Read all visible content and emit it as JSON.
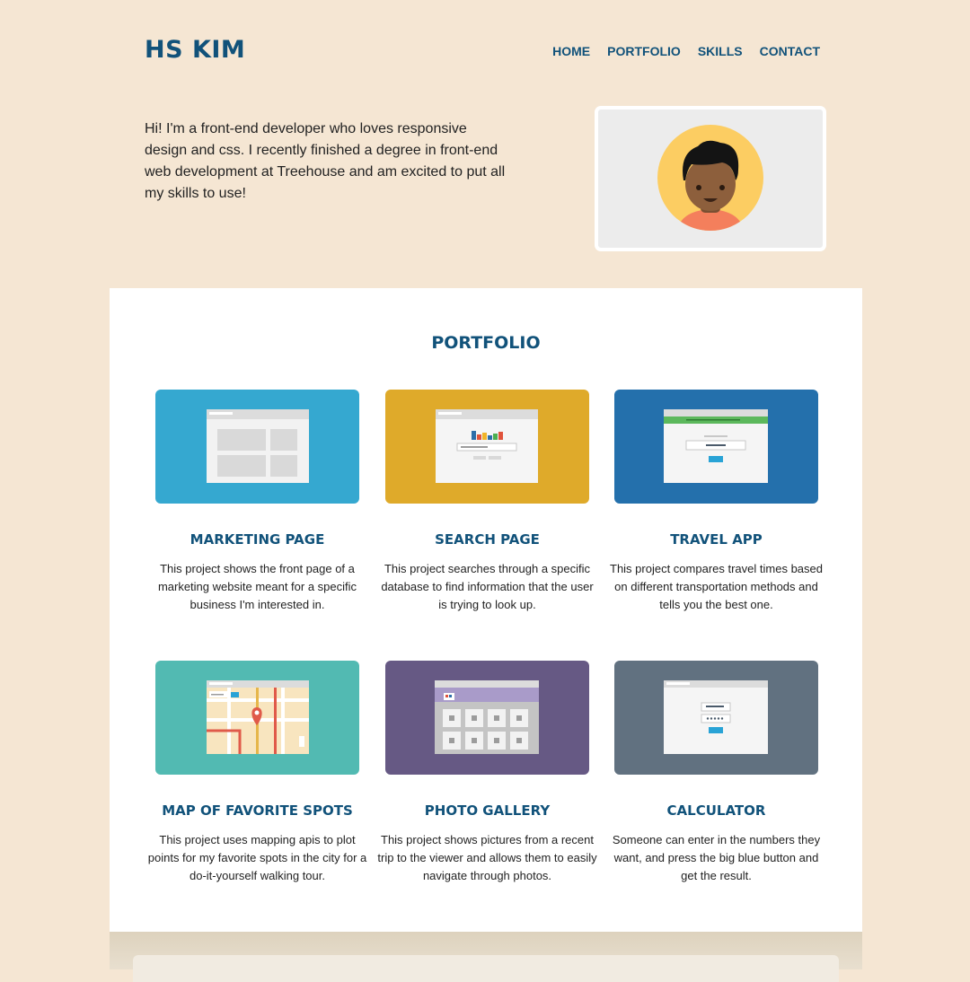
{
  "header": {
    "logo": "HS KIM",
    "nav": [
      "HOME",
      "PORTFOLIO",
      "SKILLS",
      "CONTACT"
    ]
  },
  "intro": {
    "text": "Hi! I'm a front-end developer who loves responsive design and css. I recently finished a degree in front-end web development at Treehouse and am excited to put all my skills to use!"
  },
  "portfolio": {
    "title": "PORTFOLIO",
    "projects": [
      {
        "title": "MARKETING PAGE",
        "description": "This project shows the front page of a marketing website meant for a specific business I'm interested in.",
        "color": "#35a8d0"
      },
      {
        "title": "SEARCH PAGE",
        "description": "This project searches through a specific database to find information that the user is trying to look up.",
        "color": "#dfaa2a"
      },
      {
        "title": "TRAVEL APP",
        "description": "This project compares travel times based on different transportation methods and tells you the best one.",
        "color": "#2470ac"
      },
      {
        "title": "MAP OF FAVORITE SPOTS",
        "description": "This project uses mapping apis to plot points for my favorite spots in the city for a do-it-yourself walking tour.",
        "color": "#52bab2"
      },
      {
        "title": "PHOTO GALLERY",
        "description": "This project shows pictures from a recent trip to the viewer and allows them to easily navigate through photos.",
        "color": "#665984"
      },
      {
        "title": "CALCULATOR",
        "description": "Someone can enter in the numbers they want, and press the big blue button and get the result.",
        "color": "#617180"
      }
    ]
  }
}
